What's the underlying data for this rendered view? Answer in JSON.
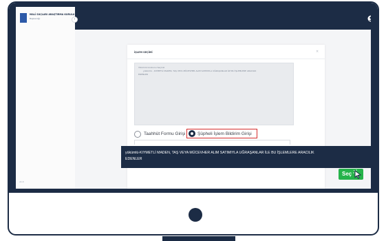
{
  "app": {
    "brand": "MALİ SUÇLARI ARAŞTIRMA KURULU",
    "brand_sub": "Başkanlığı",
    "version": "v1.0"
  },
  "modal": {
    "title": "İŞLEM SEÇİMİ",
    "close": "×",
    "textarea_lines": [
      "Yükümlü Grubunu Seçiniz",
      "yükümlü - KIYMETLİ MADEN, TAŞ VEYA MÜCEVHER ALIM SATIMIYLA UĞRAŞANLAR İLE BU İŞLEMLERE ARACILIK",
      "EDENLER"
    ]
  },
  "options": {
    "taahhut_label": "Taahhüt Formu Girişi",
    "supheli_label": "Şüpheli İşlem Bildirim Girişi"
  },
  "tooltip": {
    "line1": "yükümlü-KIYMETLİ MADEN, TAŞ VEYA MÜCEVHER ALIM SATIMIYLA UĞRAŞANLAR İLE BU İŞLEMLERE ARACILIK",
    "line2": "EDENLER"
  },
  "select_button": {
    "label": "Seç"
  },
  "colors": {
    "navy": "#1c2c45",
    "green": "#25b34a",
    "highlight_red": "#d42b2b"
  }
}
